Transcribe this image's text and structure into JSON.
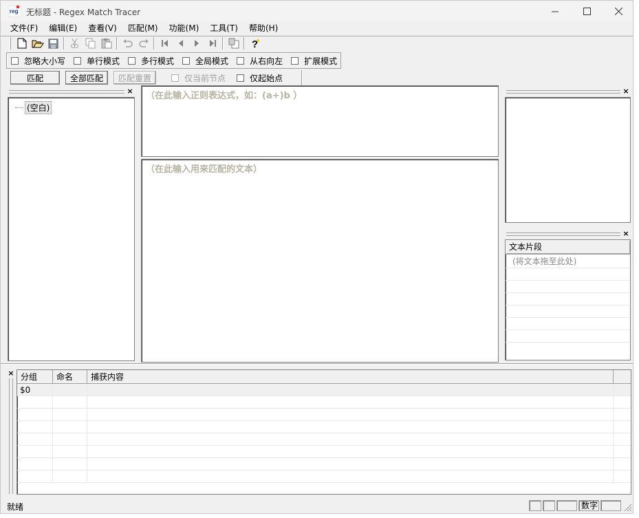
{
  "window": {
    "title": "无标题 - Regex Match Tracer",
    "app_icon_text": "reg"
  },
  "menu": [
    "文件(F)",
    "编辑(E)",
    "查看(V)",
    "匹配(M)",
    "功能(M)",
    "工具(T)",
    "帮助(H)"
  ],
  "toolbar_icons": [
    "new-file-icon",
    "open-folder-icon",
    "save-icon",
    "cut-icon",
    "copy-icon",
    "paste-icon",
    "undo-icon",
    "redo-icon",
    "first-icon",
    "previous-icon",
    "next-icon",
    "last-icon",
    "replace-icon",
    "help-icon"
  ],
  "options": [
    "忽略大小写",
    "单行模式",
    "多行模式",
    "全局模式",
    "从右向左",
    "扩展模式"
  ],
  "actions": {
    "match": "匹配",
    "match_all": "全部匹配",
    "match_reset": "匹配重置",
    "current_node_only": "仅当前节点",
    "start_point_only": "仅起始点"
  },
  "tree": {
    "root": "(空白)"
  },
  "editor": {
    "regex_hint": "（在此输入正则表达式，如：(a+)b ）",
    "text_hint": "（在此输入用来匹配的文本）"
  },
  "snippets": {
    "header": "文本片段",
    "hint": "(将文本拖至此处)"
  },
  "groups": {
    "columns": [
      "分组",
      "命名",
      "捕获内容"
    ],
    "rows": [
      {
        "group": "$0",
        "name": "",
        "capture": ""
      }
    ]
  },
  "status": {
    "text": "就绪",
    "num_indicator": "数字"
  }
}
